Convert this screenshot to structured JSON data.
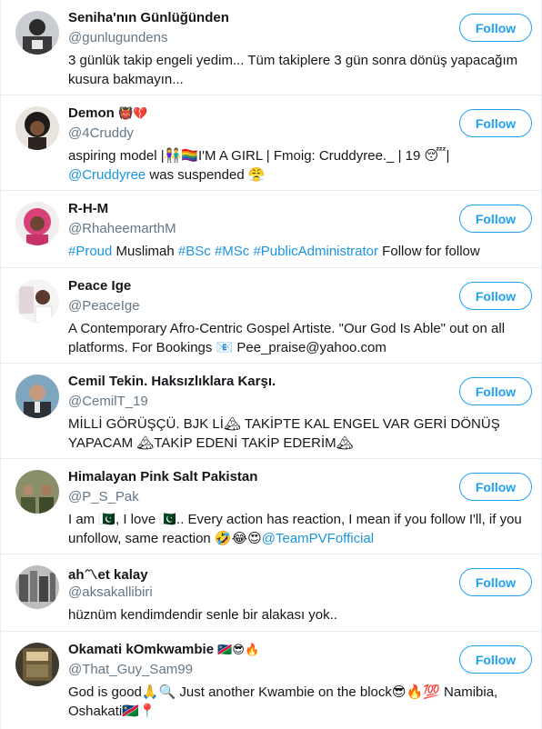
{
  "follow_label": "Follow",
  "users": [
    {
      "name": "Seniha'nın Günlüğünden",
      "handle": "@gunlugundens",
      "bio": "3 günlük takip engeli yedim... Tüm takiplere 3 gün sonra dönüş yapacağım kusura bakmayın..."
    },
    {
      "name": "Demon",
      "name_emoji": "👹💔",
      "handle": "@4Cruddy",
      "bio_parts": [
        "aspiring model |👫🏳️‍🌈I'M A GIRL | Fmoig: Cruddyree._ | 19 😴| ",
        "@Cruddyree",
        " was suspended 😤"
      ]
    },
    {
      "name": "R-H-M",
      "handle": "@RhaheemarthM",
      "bio_parts": [
        "#Proud",
        " Muslimah ",
        "#BSc",
        " ",
        "#MSc",
        " ",
        "#PublicAdministrator",
        " Follow for follow"
      ]
    },
    {
      "name": "Peace Ige",
      "handle": "@PeaceIge",
      "bio": "A Contemporary Afro-Centric Gospel Artiste. \"Our God Is Able\" out on all platforms. For Bookings 📧 Pee_praise@yahoo.com"
    },
    {
      "name": "Cemil Tekin. Haksızlıklara Karşı.",
      "handle": "@CemilT_19",
      "bio": "MİLLİ GÖRÜŞÇÜ. BJK Lİ🏔 TAKİPTE KAL ENGEL VAR GERİ DÖNÜŞ YAPACAM 🏔TAKİP EDENİ TAKİP EDERİM🏔"
    },
    {
      "name": "Himalayan Pink Salt Pakistan",
      "handle": "@P_S_Pak",
      "bio_parts": [
        "I am 🇵🇰, I love 🇵🇰.. Every action has reaction, I mean if you follow I'll, if you unfollow, same reaction 🤣😂😍",
        "@TeamPVFofficial"
      ]
    },
    {
      "name": "ah〽et kalay",
      "handle": "@aksakallibiri",
      "bio": "hüznüm kendimdendir senle bir alakası yok.."
    },
    {
      "name": "Okamati kOmkwambie",
      "name_emoji": "🇳🇦😎🔥",
      "handle": "@That_Guy_Sam99",
      "bio": "God is good🙏🔍 Just another Kwambie on the block😎🔥💯 Namibia, Oshakati🇳🇦📍"
    }
  ],
  "colors": {
    "accent": "#1da1f2",
    "link": "#1b95e0",
    "muted": "#657786",
    "divider": "#e6ecf0"
  }
}
